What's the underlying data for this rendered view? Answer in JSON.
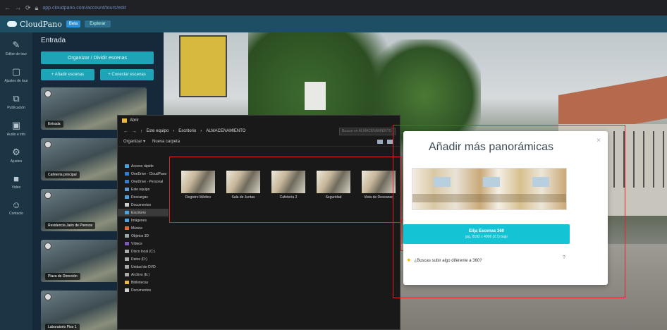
{
  "browser": {
    "url": "app.cloudpano.com/account/tours/edit"
  },
  "app": {
    "brand": "CloudPano",
    "badge": "Beta",
    "nav_button": "Explorar"
  },
  "leftnav": [
    {
      "label": "Editor de tour"
    },
    {
      "label": "Ajustes de tour"
    },
    {
      "label": "Publicación"
    },
    {
      "label": "Audio e info"
    },
    {
      "label": "Ajustes"
    },
    {
      "label": "Video"
    },
    {
      "label": "Contacto"
    }
  ],
  "scenes": {
    "title": "Entrada",
    "main_button": "Organizar / Dividir escenas",
    "btn_left": "+ Añadir escenas",
    "btn_right": "+ Conectar escenas",
    "items": [
      {
        "label": "Entrada"
      },
      {
        "label": "Cafetería principal"
      },
      {
        "label": "Residencia Jaén de Piensos"
      },
      {
        "label": "Plaza de Dirección"
      },
      {
        "label": "Laboratorio Piso 1"
      }
    ]
  },
  "explorer": {
    "title": "Abrir",
    "path": [
      "Este equipo",
      "Escritorio",
      "ALMACENAMIENTO"
    ],
    "search_placeholder": "Buscar en ALMACENAMIENTO",
    "organize": "Organizar ▾",
    "new_folder": "Nueva carpeta",
    "sidebar": [
      "Acceso rápido",
      "OneDrive - CloudPano",
      "OneDrive - Personal",
      "Este equipo",
      "Descargas",
      "Documentos",
      "Escritorio",
      "Imágenes",
      "Música",
      "Objetos 3D",
      "Vídeos",
      "Disco local (C:)",
      "Datos (D:)",
      "Unidad de DVD",
      "Archivo (E:)",
      "Bibliotecas",
      "Documentos"
    ],
    "selected_sidebar_index": 6,
    "files": [
      "Registro Médico",
      "Sala de Juntas",
      "Cafetería 2",
      "Seguridad",
      "Vista de Descanso"
    ]
  },
  "modal": {
    "title": "Añadir más panorámicas",
    "primary_line1": "Elija Escenas 360",
    "primary_line2": "jpg, 8192 x 4096 (2:1) bajo",
    "more_text": "¿Buscas subir algo diferente a 360?",
    "help": "?"
  }
}
